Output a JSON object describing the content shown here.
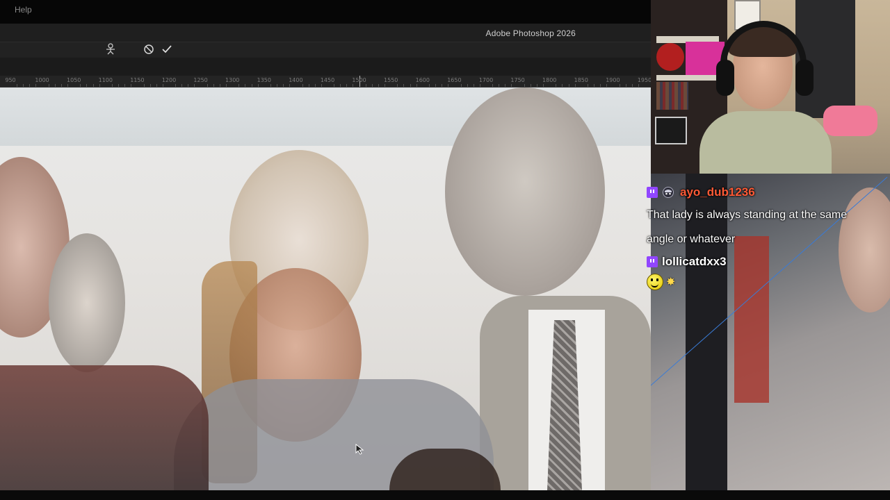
{
  "menu": {
    "help_label": "Help"
  },
  "app": {
    "title": "Adobe Photoshop 2026"
  },
  "options_bar": {
    "icons": [
      "puppet-warp-icon",
      "cancel-icon",
      "commit-check-icon"
    ]
  },
  "ruler": {
    "labels": [
      "950",
      "1000",
      "1050",
      "1100",
      "1150",
      "1200",
      "1250",
      "1300",
      "1350",
      "1400",
      "1450",
      "1500",
      "1550",
      "1600",
      "1650",
      "1700",
      "1750",
      "1800",
      "1850",
      "1900",
      "1950"
    ]
  },
  "chat": {
    "messages": [
      {
        "username": "ayo_dub1236",
        "username_color": "#ff5a36",
        "badges": [
          "twitch-badge-icon",
          "bandana-badge-icon"
        ],
        "text_line1": "That lady is always standing at the same",
        "text_line2": "angle or whatever"
      },
      {
        "username": "lollicatdxx3",
        "username_color": "#ffffff",
        "badges": [
          "twitch-badge-icon"
        ],
        "emotes": [
          "smiley-emote",
          "sparkle-emote"
        ]
      }
    ]
  },
  "colors": {
    "twitch_purple": "#9146ff",
    "ps_panel": "#1f1f1f"
  }
}
